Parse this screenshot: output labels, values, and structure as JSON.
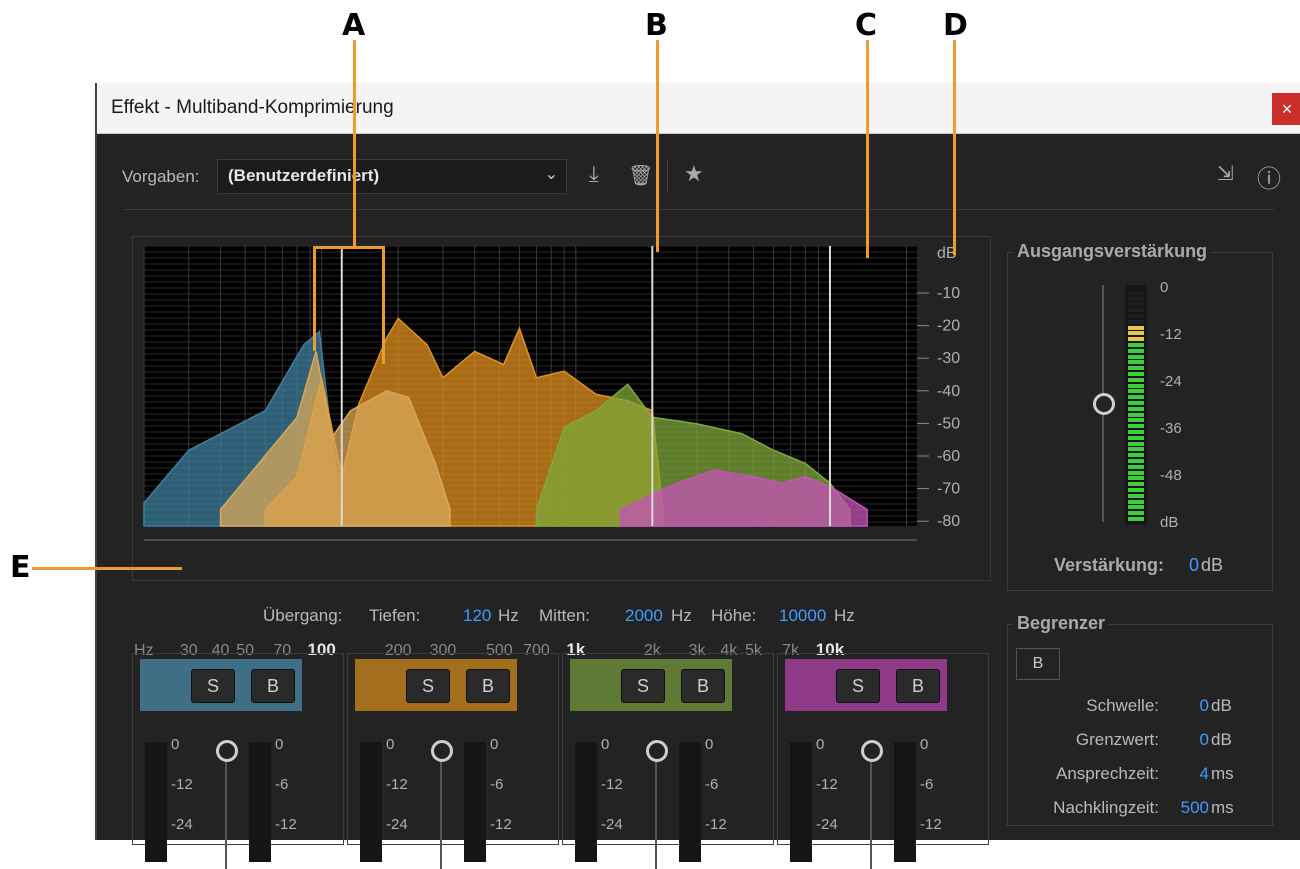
{
  "callouts": {
    "a": "A",
    "b": "B",
    "c": "C",
    "d": "D",
    "e": "E"
  },
  "window": {
    "title": "Effekt - Multiband-Komprimierung",
    "close": "×"
  },
  "toolbar": {
    "preset_label": "Vorgaben:",
    "preset_value": "(Benutzerdefiniert)",
    "dropdown_arrow": "⌄",
    "save_icon": "⤓",
    "delete_icon": "🗑",
    "favorite_icon": "★",
    "routing_icon": "⇲",
    "info_icon": "ⓘ"
  },
  "graph": {
    "db_unit": "dB",
    "db_ticks": [
      "-10",
      "-20",
      "-30",
      "-40",
      "-50",
      "-60",
      "-70",
      "-80"
    ],
    "hz_unit": "Hz",
    "freq_labels": [
      {
        "t": "30",
        "bold": false
      },
      {
        "t": "40",
        "bold": false
      },
      {
        "t": "50",
        "bold": false
      },
      {
        "t": "70",
        "bold": false
      },
      {
        "t": "100",
        "bold": true
      },
      {
        "t": "200",
        "bold": false
      },
      {
        "t": "300",
        "bold": false
      },
      {
        "t": "500",
        "bold": false
      },
      {
        "t": "700",
        "bold": false
      },
      {
        "t": "1k",
        "bold": true
      },
      {
        "t": "2k",
        "bold": false
      },
      {
        "t": "3k",
        "bold": false
      },
      {
        "t": "4k",
        "bold": false
      },
      {
        "t": "5k",
        "bold": false
      },
      {
        "t": "7k",
        "bold": false
      },
      {
        "t": "10k",
        "bold": true
      }
    ],
    "band_colors": [
      "#3f7f9e",
      "#e0901e",
      "#7fa83a",
      "#c653b8"
    ]
  },
  "crossover": {
    "label": "Übergang:",
    "low_label": "Tiefen:",
    "low_value": "120",
    "low_unit": "Hz",
    "mid_label": "Mitten:",
    "mid_value": "2000",
    "mid_unit": "Hz",
    "high_label": "Höhe:",
    "high_value": "10000",
    "high_unit": "Hz"
  },
  "output": {
    "title": "Ausgangsverstärkung",
    "scale": [
      "0",
      "-12",
      "-24",
      "-36",
      "-48",
      "dB"
    ],
    "gain_label": "Verstärkung:",
    "gain_value": "0",
    "gain_unit": "dB",
    "level_fraction": 0.84
  },
  "limiter": {
    "title": "Begrenzer",
    "bypass": "B",
    "rows": [
      {
        "label": "Schwelle:",
        "value": "0",
        "unit": "dB"
      },
      {
        "label": "Grenzwert:",
        "value": "0",
        "unit": "dB"
      },
      {
        "label": "Ansprechzeit:",
        "value": "4",
        "unit": "ms"
      },
      {
        "label": "Nachklingzeit:",
        "value": "500",
        "unit": "ms"
      }
    ]
  },
  "bands": [
    {
      "color": "#3e6f84",
      "solo": "S",
      "bypass": "B",
      "scale_left": [
        "0",
        "-12",
        "-24"
      ],
      "scale_right": [
        "0",
        "-6",
        "-12"
      ]
    },
    {
      "color": "#a36f1c",
      "solo": "S",
      "bypass": "B",
      "scale_left": [
        "0",
        "-12",
        "-24"
      ],
      "scale_right": [
        "0",
        "-6",
        "-12"
      ]
    },
    {
      "color": "#5f7a34",
      "solo": "S",
      "bypass": "B",
      "scale_left": [
        "0",
        "-12",
        "-24"
      ],
      "scale_right": [
        "0",
        "-6",
        "-12"
      ]
    },
    {
      "color": "#8e3a86",
      "solo": "S",
      "bypass": "B",
      "scale_left": [
        "0",
        "-12",
        "-24"
      ],
      "scale_right": [
        "0",
        "-6",
        "-12"
      ]
    }
  ]
}
